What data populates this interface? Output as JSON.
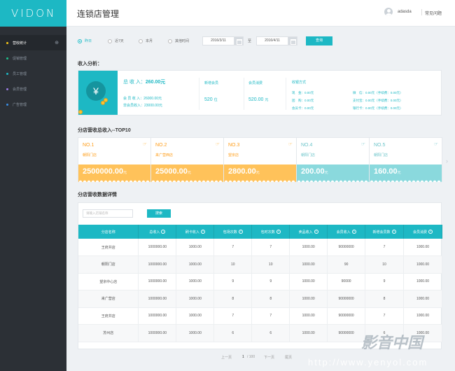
{
  "app": {
    "logo": "VIDON",
    "page_title": "连锁店管理",
    "username": "adasda",
    "help": "常见问题"
  },
  "sidebar": {
    "items": [
      {
        "label": "营收统计",
        "dot": "#f5c518",
        "arrow": "⊕"
      },
      {
        "label": "促销管理",
        "dot": "#1ec28b"
      },
      {
        "label": "员工管理",
        "dot": "#1db8c4"
      },
      {
        "label": "会员管理",
        "dot": "#9b7be6"
      },
      {
        "label": "广告管理",
        "dot": "#3a8ee6"
      }
    ]
  },
  "filter": {
    "options": [
      "昨日",
      "近7天",
      "本月",
      "其他时间"
    ],
    "selected": "昨日",
    "start_date": "2016/3/11",
    "to_label": "至",
    "end_date": "2016/4/11",
    "query": "查询"
  },
  "analysis": {
    "heading": "收入分析：",
    "total_label": "总 收 入：",
    "total_value": "260.00元",
    "member_income": "会 员 收 入：26000.00元",
    "non_member_income": "非会员收入：23000.00元",
    "new_members_label": "新增会员",
    "new_members_value": "520",
    "new_members_unit": "位",
    "member_spend_label": "会员消费",
    "member_spend_value": "520.00",
    "member_spend_unit": "元",
    "payment_label": "收银方式",
    "payments_left": [
      "现　金：0.00元",
      "团　购：0.00元",
      "会员卡：0.00元"
    ],
    "payments_right": [
      "微　信：0.00元（手续费：0.00元）",
      "支付宝：0.00元（手续费：0.00元）",
      "银行卡：0.00元（手续费：0.00元）"
    ]
  },
  "top10": {
    "heading": "分店营收总收入--TOP10",
    "cards": [
      {
        "rank": "NO.1",
        "store": "朝阳门店",
        "amount": "2500000.00",
        "unit": "元"
      },
      {
        "rank": "NO.2",
        "store": "来广营西店",
        "amount": "25000.00",
        "unit": "元"
      },
      {
        "rank": "NO.3",
        "store": "望京店",
        "amount": "2800.00",
        "unit": "元"
      },
      {
        "rank": "NO.4",
        "store": "朝阳门店",
        "amount": "200.00",
        "unit": "元"
      },
      {
        "rank": "NO.5",
        "store": "朝阳门店",
        "amount": "160.00",
        "unit": "元"
      }
    ]
  },
  "detail": {
    "heading": "分店营收数据详情",
    "search_placeholder": "请输入店铺名称",
    "search_btn": "搜索",
    "columns": [
      "分店名称",
      "总收入",
      "刷卡收入",
      "包场次数",
      "包时次数",
      "卖品收入",
      "会员收入",
      "新增会员数",
      "会员消费"
    ],
    "rows": [
      [
        "王府井店",
        "1000000.00",
        "1000.00",
        "7",
        "7",
        "1000.00",
        "90000000",
        "7",
        "1000.00"
      ],
      [
        "朝阳门店",
        "1000000.00",
        "1000.00",
        "10",
        "10",
        "1000.00",
        "90",
        "10",
        "1000.00"
      ],
      [
        "望京中心店",
        "1000000.00",
        "1000.00",
        "9",
        "9",
        "1000.00",
        "90000",
        "9",
        "1000.00"
      ],
      [
        "来广营店",
        "1000000.00",
        "1000.00",
        "8",
        "8",
        "1000.00",
        "90000000",
        "8",
        "1000.00"
      ],
      [
        "王府井店",
        "1000000.00",
        "1000.00",
        "7",
        "7",
        "1000.00",
        "90000000",
        "7",
        "1000.00"
      ],
      [
        "苏州店",
        "1000000.00",
        "1000.00",
        "6",
        "6",
        "1000.00",
        "90000000",
        "6",
        "1000.00"
      ]
    ]
  },
  "pager": {
    "prev": "上一页",
    "current": "1",
    "total": "/ 100",
    "next": "下一页",
    "last": "尾页"
  },
  "watermark": {
    "brand": "影音中国",
    "url": "http://www.yenyol.com"
  }
}
